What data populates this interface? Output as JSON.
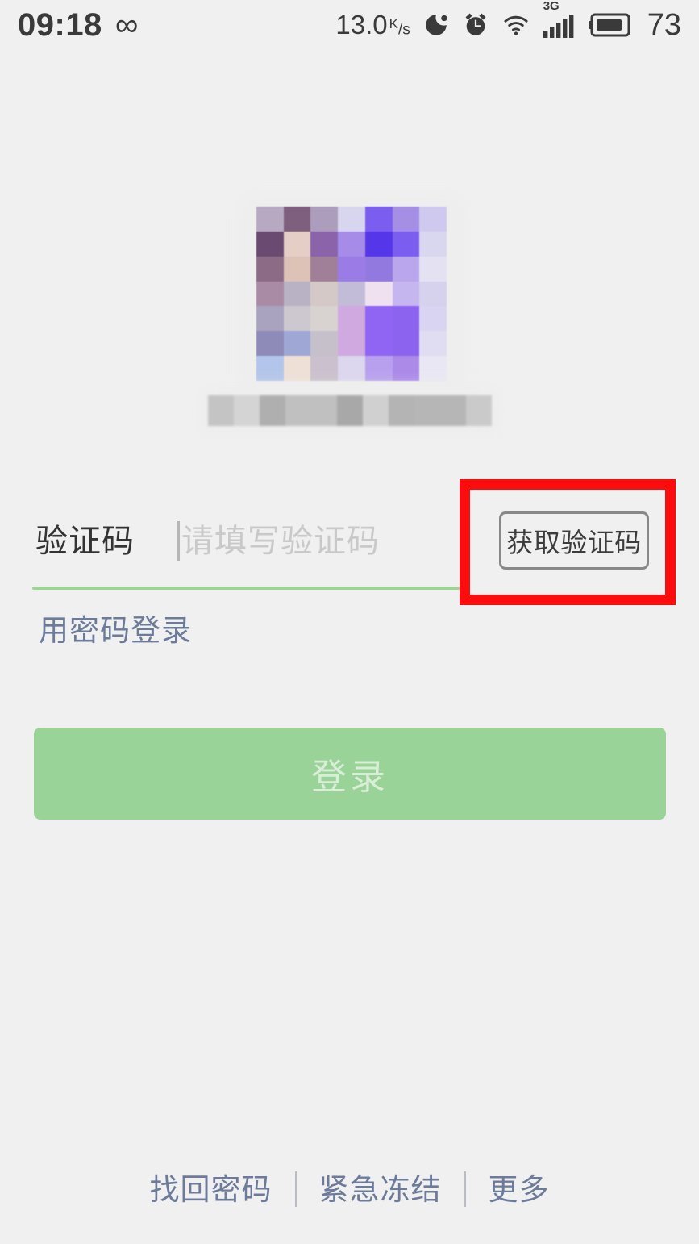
{
  "status_bar": {
    "time": "09:18",
    "infinity_glyph": "∞",
    "net_speed": "13.0",
    "net_speed_unit_numer": "K",
    "net_speed_unit_denom": "s",
    "network_type": "3G",
    "battery_percent": "73",
    "icons": [
      "do-not-disturb-icon",
      "alarm-clock-icon",
      "wifi-icon",
      "signal-bars-icon",
      "battery-icon"
    ]
  },
  "logo": {
    "alt": "blurred-app-logo",
    "app_name_alt": "blurred-app-name",
    "censored": true
  },
  "form": {
    "code_label": "验证码",
    "code_placeholder": "请填写验证码",
    "code_value": "",
    "get_code_button": "获取验证码",
    "password_login_link": "用密码登录",
    "login_button": "登录"
  },
  "annotation": {
    "highlight_color": "#fb0d0d",
    "target": "获取验证码"
  },
  "colors": {
    "background": "#f0f0f0",
    "underline_green": "#9ed396",
    "login_green": "#9ad397",
    "link_blue": "#6c7b99",
    "label_dark": "#333333",
    "placeholder_gray": "#c9c9c9"
  },
  "footer": {
    "links": [
      {
        "label": "找回密码"
      },
      {
        "label": "紧急冻结"
      },
      {
        "label": "更多"
      }
    ]
  },
  "mosaic_blocks": [
    "#b7a9c2",
    "#7e5f7d",
    "#ad9dbc",
    "#d8d6ef",
    "#7b5ef0",
    "#a58fe4",
    "#cfc9f0",
    "#6b4a72",
    "#e5cec6",
    "#8a63ab",
    "#a68ce8",
    "#5536e8",
    "#7b5ef0",
    "#d9d6ef",
    "#8c6b87",
    "#ddc2b8",
    "#a08099",
    "#9b7ce6",
    "#9279e0",
    "#b9a6ec",
    "#e4e2f2",
    "#a98ba6",
    "#b9b2c4",
    "#d4c9c7",
    "#c2bcd8",
    "#efe1f0",
    "#c6b6ef",
    "#d6d2ee",
    "#a9a3c0",
    "#cdc7cf",
    "#d8d2d0",
    "#cfa9e0",
    "#9065f3",
    "#8b63ef",
    "#d8d4f1",
    "#8e8bb8",
    "#9fa7d4",
    "#c6c0cb",
    "#cfa9e0",
    "#9065f3",
    "#8b63ef",
    "#e0ddf2",
    "#b3c5ea",
    "#eee0d6",
    "#cbc0cd",
    "#dcd6ee",
    "#b9a0ef",
    "#ab8ae8",
    "#e9e7f3"
  ],
  "namebar_blocks": [
    "#c4c4c4",
    "#d4d4d4",
    "#afafaf",
    "#c0c0c0",
    "#c0c0c0",
    "#a8a8a8",
    "#d0d0d0",
    "#b4b4b4",
    "#b6b6b6",
    "#b6b6b6",
    "#cacaca"
  ]
}
